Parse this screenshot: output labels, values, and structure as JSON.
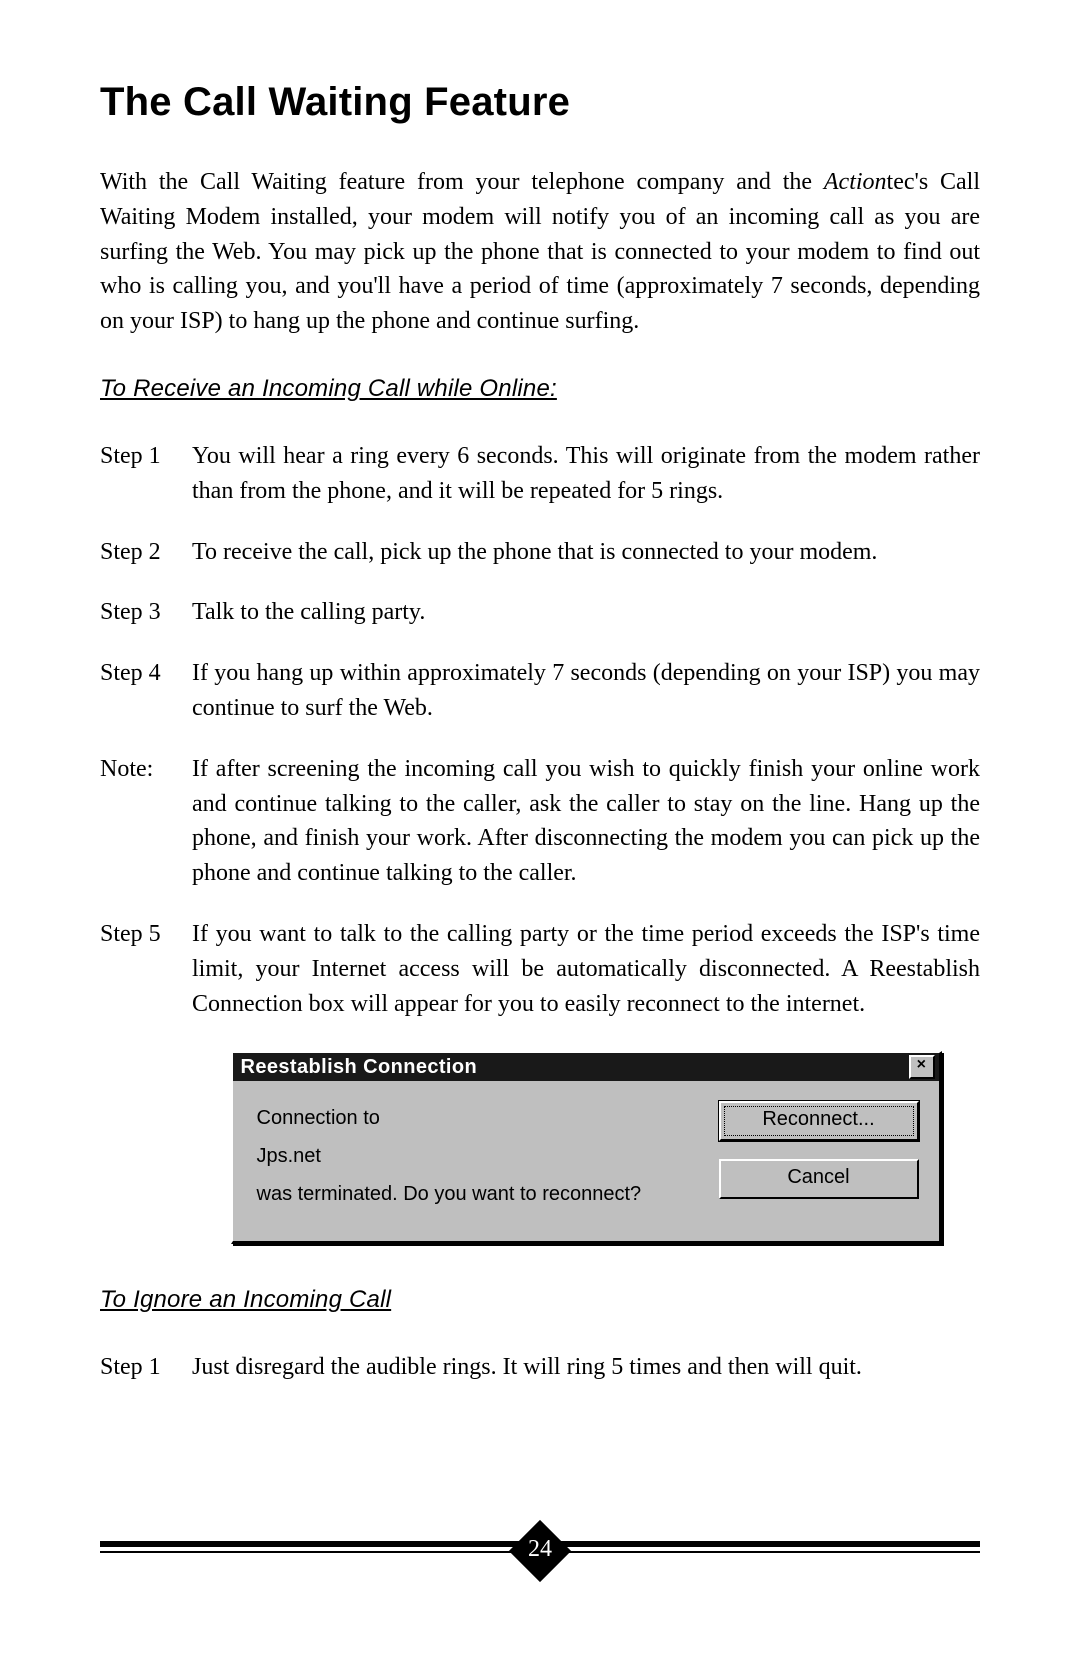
{
  "title": "The Call Waiting Feature",
  "intro": {
    "prefix": "With the Call Waiting feature from your telephone company and the ",
    "brand_italic": "Action",
    "suffix": "tec's Call Waiting Modem installed, your modem will notify you of an incoming call as you are surfing the Web. You may pick up the phone that is connected to your modem to find out who is calling you, and you'll have a period of time (approximately 7 seconds, depending on your ISP) to hang up the phone and continue surfing."
  },
  "section1": {
    "heading": "To Receive an Incoming Call while Online:",
    "items": [
      {
        "label": "Step 1",
        "text": "You will hear a ring every 6 seconds.  This will originate from the modem rather than  from the phone, and it will be repeated for 5 rings."
      },
      {
        "label": "Step 2",
        "text": "To receive the call, pick up the phone that is connected to your modem."
      },
      {
        "label": "Step 3",
        "text": "Talk to the calling party."
      },
      {
        "label": "Step 4",
        "text": "If you hang up within approximately 7 seconds (depending on your ISP) you may continue to surf the Web."
      },
      {
        "label": "Note:",
        "text": "If after screening the incoming call you wish to quickly finish your online work and continue talking to the caller, ask the caller to stay on the line. Hang up the phone, and finish your work. After disconnecting the modem you can pick up the phone and continue talking to the caller."
      },
      {
        "label": "Step 5",
        "text": "If you want to talk to the calling party or the time period exceeds the ISP's time limit, your Internet access will be automatically disconnected.  A Reestablish Connection box will appear for you to easily reconnect to the internet."
      }
    ]
  },
  "dialog": {
    "title": "Reestablish Connection",
    "close": "×",
    "line1": "Connection to",
    "line2": "Jps.net",
    "line3": "was terminated. Do you want to reconnect?",
    "buttons": {
      "reconnect": "Reconnect...",
      "cancel": "Cancel"
    }
  },
  "section2": {
    "heading": "To  Ignore an Incoming Call",
    "items": [
      {
        "label": "Step 1",
        "text": "Just disregard the audible rings. It will ring 5 times and then will quit."
      }
    ]
  },
  "page_number": "24"
}
